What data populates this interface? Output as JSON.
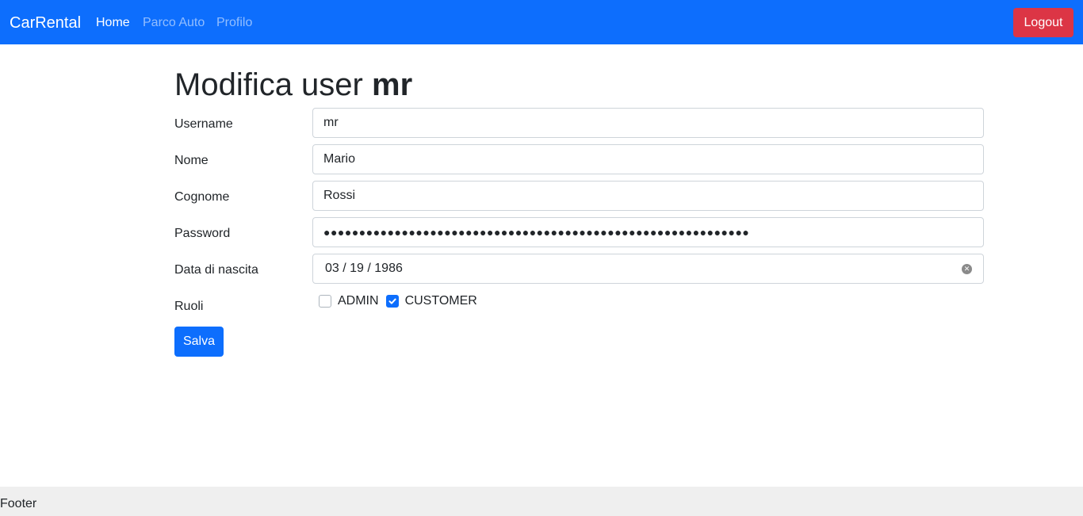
{
  "navbar": {
    "brand": "CarRental",
    "links": [
      {
        "label": "Home"
      },
      {
        "label": "Parco Auto"
      },
      {
        "label": "Profilo"
      }
    ],
    "logout_label": "Logout",
    "bg_color": "#0d6efd",
    "logout_color": "#dc3545"
  },
  "page": {
    "title_prefix": "Modifica user",
    "title_user": "mr"
  },
  "form": {
    "username": {
      "label": "Username",
      "value": "mr"
    },
    "nome": {
      "label": "Nome",
      "value": "Mario"
    },
    "cognome": {
      "label": "Cognome",
      "value": "Rossi"
    },
    "password": {
      "label": "Password",
      "masked_value": "●●●●●●●●●●●●●●●●●●●●●●●●●●●●●●●●●●●●●●●●●●●●●●●●●●●●●●●●●●●●"
    },
    "data_nascita": {
      "label": "Data di nascita",
      "value": "03 / 19 / 1986"
    },
    "ruoli": {
      "label": "Ruoli",
      "options": [
        {
          "label": "ADMIN",
          "checked": false
        },
        {
          "label": "CUSTOMER",
          "checked": true
        }
      ]
    },
    "save_label": "Salva"
  },
  "footer": {
    "text": "Footer"
  }
}
